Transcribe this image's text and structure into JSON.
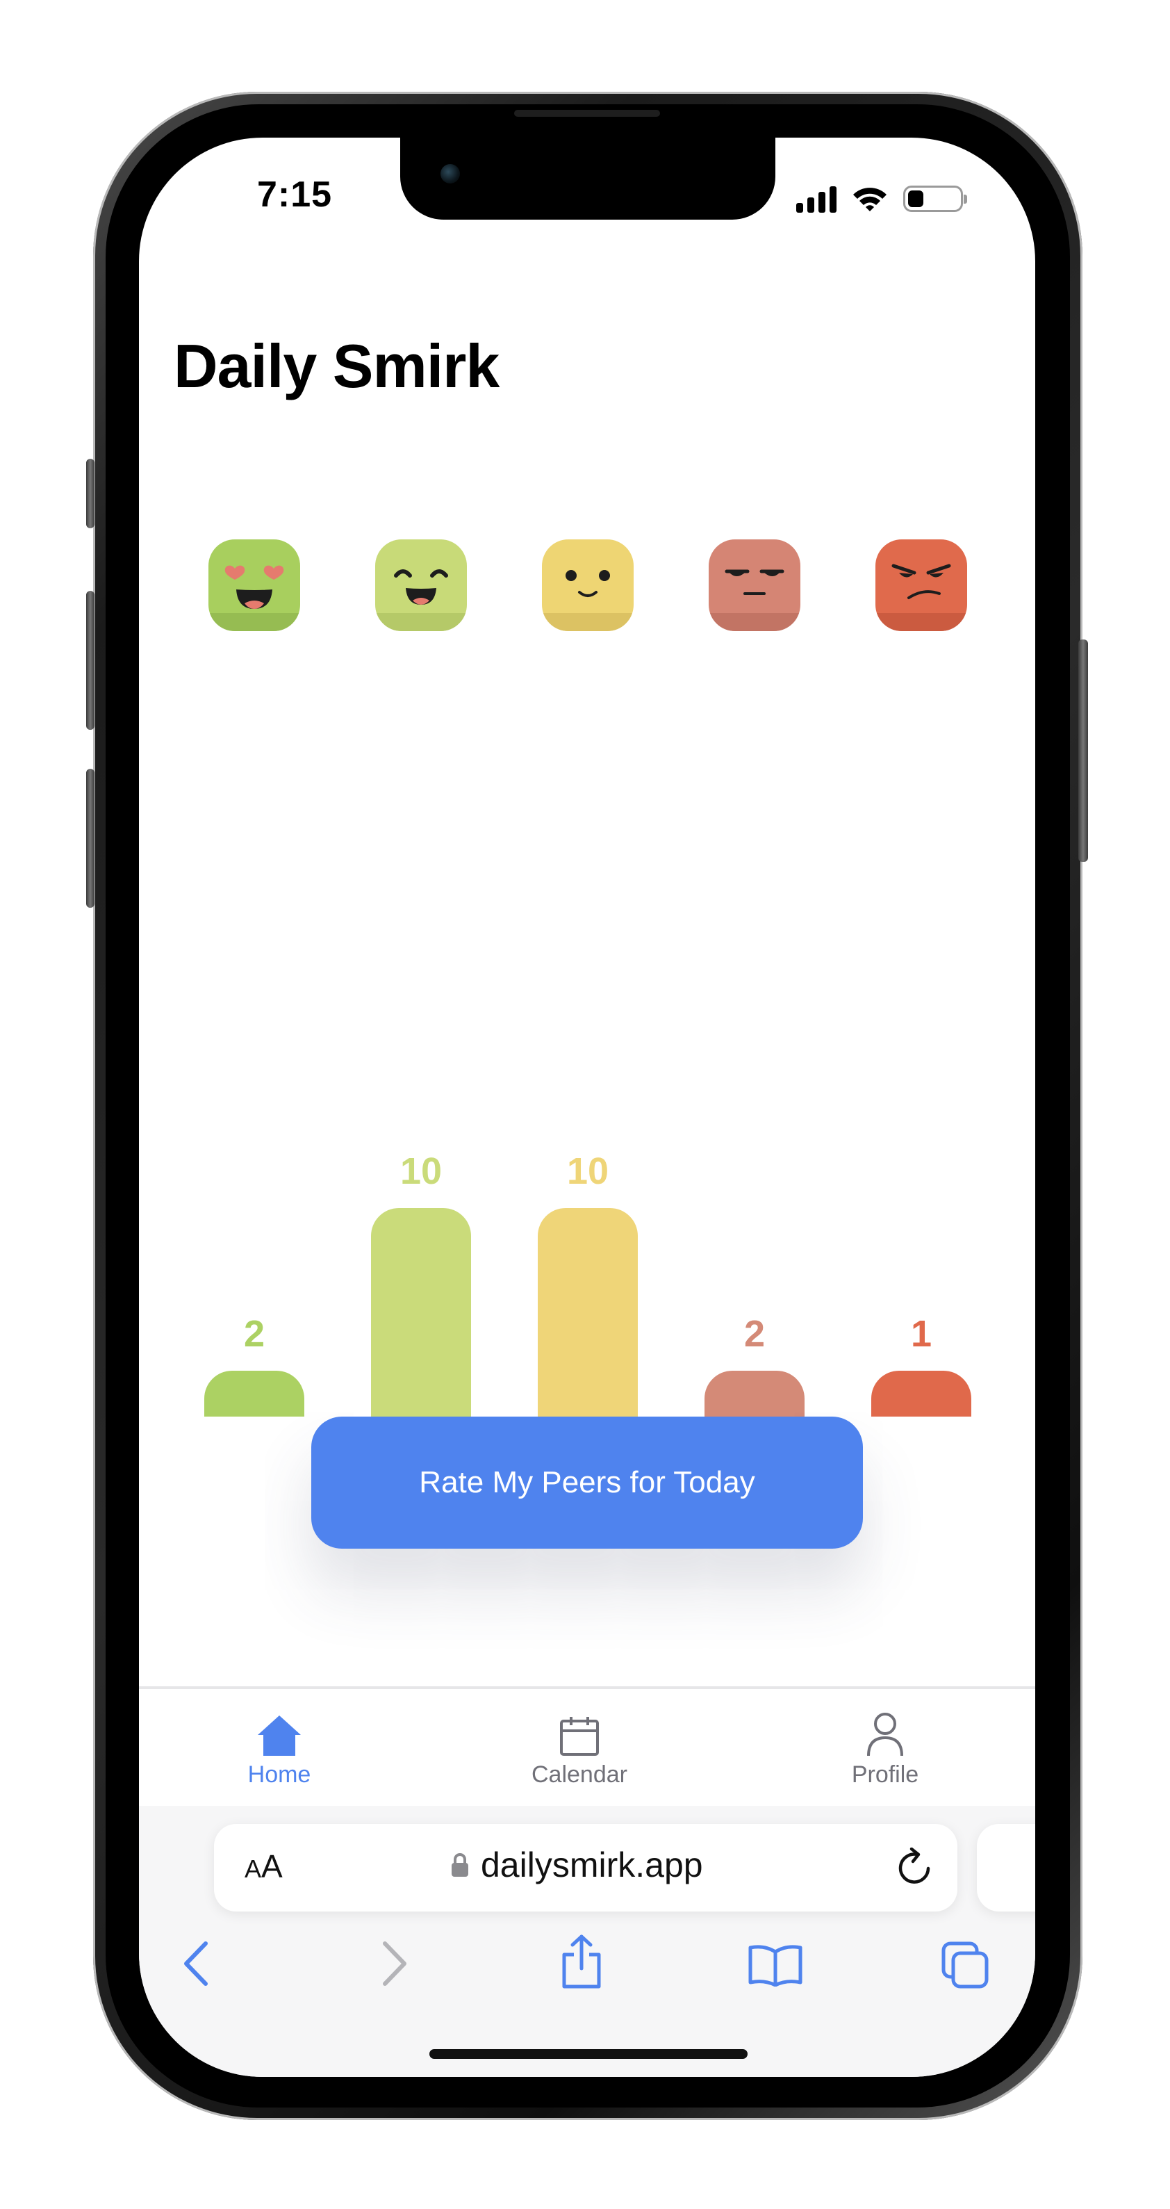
{
  "status_bar": {
    "time": "7:15"
  },
  "app": {
    "title": "Daily Smirk"
  },
  "moods": [
    {
      "name": "love",
      "color": "#a8cf5e",
      "shade": "#93b951"
    },
    {
      "name": "happy",
      "color": "#c8da78",
      "shade": "#b3c766"
    },
    {
      "name": "neutral",
      "color": "#eed573",
      "shade": "#d9c062"
    },
    {
      "name": "annoyed",
      "color": "#d58574",
      "shade": "#c07263"
    },
    {
      "name": "angry",
      "color": "#e06a4c",
      "shade": "#c95a3f"
    }
  ],
  "chart_data": {
    "type": "bar",
    "categories": [
      "love",
      "happy",
      "neutral",
      "annoyed",
      "angry"
    ],
    "values": [
      2,
      10,
      10,
      2,
      1
    ],
    "colors": [
      "#acd163",
      "#cadb7a",
      "#efd578",
      "#d48a77",
      "#e0694b"
    ],
    "ylim": [
      0,
      10
    ]
  },
  "cta": {
    "label": "Rate My Peers for Today"
  },
  "tab_bar": {
    "active_color": "#4f83ee",
    "inactive_color": "#707078",
    "items": [
      {
        "label": "Home",
        "icon": "home-icon",
        "active": true
      },
      {
        "label": "Calendar",
        "icon": "calendar-icon",
        "active": false
      },
      {
        "label": "Profile",
        "icon": "profile-icon",
        "active": false
      }
    ]
  },
  "browser": {
    "text_size_button": "AA",
    "url": "dailysmirk.app",
    "icons": [
      "lock-icon",
      "reload-icon",
      "back-icon",
      "forward-icon",
      "share-icon",
      "bookmarks-icon",
      "tabs-icon"
    ]
  }
}
